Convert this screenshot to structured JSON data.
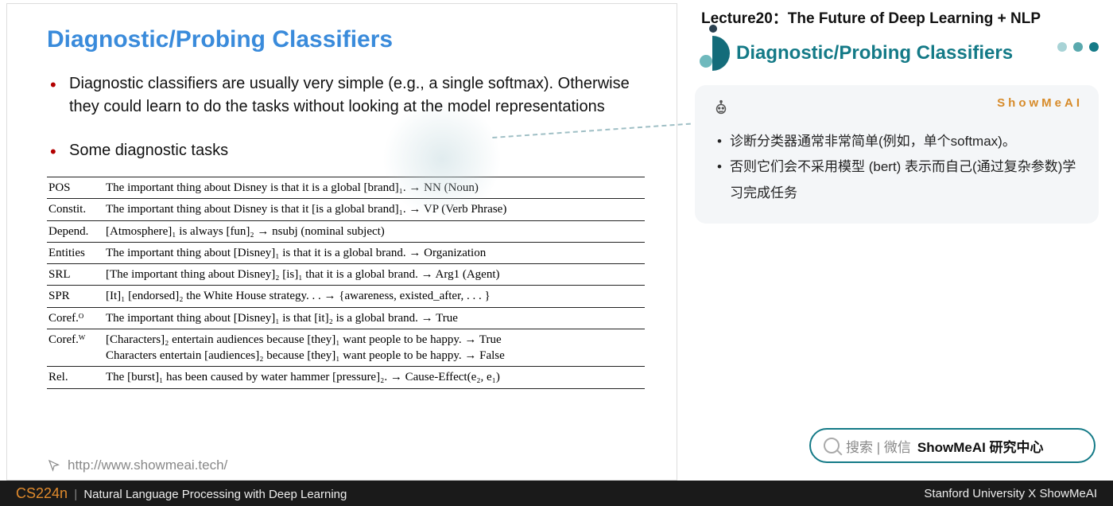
{
  "lecture_header": "Lecture20：The Future of Deep Learning + NLP",
  "slide": {
    "title": "Diagnostic/Probing Classifiers",
    "bullet1": "Diagnostic classifiers are usually very simple (e.g., a single softmax). Otherwise they could learn to do the tasks without looking at the model representations",
    "bullet2": "Some diagnostic tasks",
    "footer_url": "http://www.showmeai.tech/"
  },
  "tasks": [
    {
      "name": "POS",
      "text": "The important thing about Disney is that it is a global [brand]₁. → NN (Noun)"
    },
    {
      "name": "Constit.",
      "text": "The important thing about Disney is that it [is a global brand]₁. → VP (Verb Phrase)"
    },
    {
      "name": "Depend.",
      "text": "[Atmosphere]₁ is always [fun]₂ → nsubj (nominal subject)"
    },
    {
      "name": "Entities",
      "text": "The important thing about [Disney]₁ is that it is a global brand. → Organization"
    },
    {
      "name": "SRL",
      "text": "[The important thing about Disney]₂ [is]₁ that it is a global brand. → Arg1 (Agent)"
    },
    {
      "name": "SPR",
      "text": "[It]₁ [endorsed]₂ the White House strategy. . . → {awareness, existed_after, . . . }"
    },
    {
      "name": "Coref.ᴼ",
      "text": "The important thing about [Disney]₁ is that [it]₂ is a global brand. → True"
    },
    {
      "name": "Coref.ᵂ",
      "text": "[Characters]₂ entertain audiences because [they]₁ want people to be happy. → True\nCharacters entertain [audiences]₂ because [they]₁ want people to be happy. → False"
    },
    {
      "name": "Rel.",
      "text": "The [burst]₁ has been caused by water hammer [pressure]₂. → Cause-Effect(e₂, e₁)"
    }
  ],
  "section_title": "Diagnostic/Probing Classifiers",
  "note": {
    "brand": "ShowMeAI",
    "items": [
      "诊断分类器通常非常简单(例如，单个softmax)。",
      "否则它们会不采用模型 (bert) 表示而自己(通过复杂参数)学习完成任务"
    ]
  },
  "search": {
    "prefix": "搜索 | 微信",
    "bold": "ShowMeAI 研究中心"
  },
  "footer": {
    "course_code": "CS224n",
    "course_title": "Natural Language Processing with Deep Learning",
    "right": "Stanford University X ShowMeAI"
  }
}
